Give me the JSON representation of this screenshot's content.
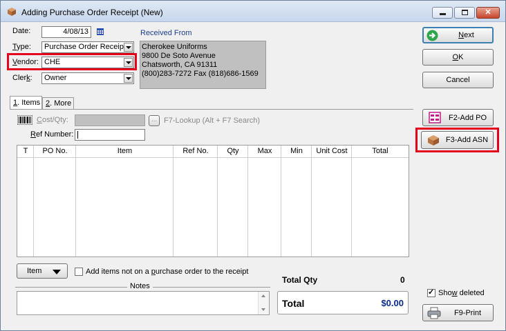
{
  "window": {
    "title": "Adding Purchase Order Receipt  (New)"
  },
  "form": {
    "date_label": "Date:",
    "date_value": "4/08/13",
    "type_label": "Type:",
    "type_value": "Purchase Order Receipt",
    "vendor_label": "Vendor:",
    "vendor_value": "CHE",
    "clerk_label": "Clerk:",
    "clerk_value": "Owner"
  },
  "received_from": {
    "label": "Received From",
    "lines": [
      "Cherokee Uniforms",
      "9800 De Soto Avenue",
      "Chatsworth, CA 91311",
      "(800)283-7272 Fax (818)686-1569"
    ]
  },
  "tabs": [
    {
      "label": "1. Items",
      "active": true
    },
    {
      "label": "2. More",
      "active": false
    }
  ],
  "items_tab": {
    "cost_qty_label": "Cost/Qty:",
    "lookup_button": "...",
    "lookup_hint": "F7-Lookup  (Alt + F7 Search)",
    "ref_number_label": "Ref Number:",
    "ref_number_value": ""
  },
  "grid": {
    "columns": [
      "T",
      "PO No.",
      "Item",
      "Ref No.",
      "Qty",
      "Max",
      "Min",
      "Unit Cost",
      "Total"
    ],
    "rows": []
  },
  "bottom": {
    "item_button": "Item",
    "add_items_checkbox_label": "Add items not on a purchase order to the receipt",
    "add_items_checked": false,
    "notes_label": "Notes",
    "notes_value": "",
    "total_qty_label": "Total Qty",
    "total_qty_value": "0",
    "total_label": "Total",
    "total_value": "$0.00"
  },
  "side_buttons": {
    "next": "Next",
    "ok": "OK",
    "cancel": "Cancel",
    "add_po": "F2-Add PO",
    "add_asn": "F3-Add ASN",
    "show_deleted": "Show deleted",
    "show_deleted_checked": true,
    "print": "F9-Print"
  },
  "colors": {
    "highlight": "#e4001b",
    "received_from_bg": "#c0c0c0",
    "label_blue": "#1a3f8f"
  }
}
